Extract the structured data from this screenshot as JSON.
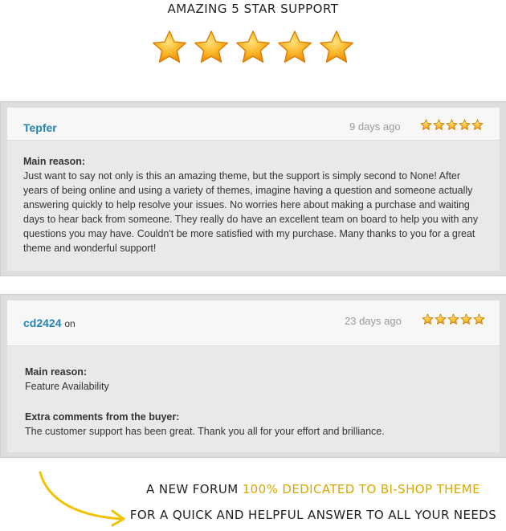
{
  "header": {
    "title": "AMAZING 5 STAR SUPPORT",
    "rating": 5
  },
  "reviews": [
    {
      "reviewer": "Tepfer",
      "reviewer_suffix": "",
      "time": "9 days ago",
      "rating": 5,
      "reason_label": "Main reason:",
      "body": "Just want to say not only is this an amazing theme, but the support is simply second to None! After years of being online and using a variety of themes, imagine having a question and someone actually answering quickly to help resolve your issues. No worries here about making a purchase and waiting days to hear back from someone. They really do have an excellent team on board to help you with any questions you may have. Couldn't be more satisfied with my purchase. Many thanks to you for a great theme and wonderful support!"
    },
    {
      "reviewer": "cd2424",
      "reviewer_suffix": "on",
      "time": "23 days ago",
      "rating": 5,
      "reason_label": "Main reason:",
      "reason_value": "Feature Availability",
      "comments_label": "Extra comments from the buyer:",
      "comments": "The customer support has been great. Thank you all for your effort and brilliance."
    }
  ],
  "footer": {
    "line1_pre": "A NEW FORUM",
    "line1_highlight": "100% DEDICATED TO BI-SHOP THEME",
    "line2": "FOR A QUICK AND HELPFUL ANSWER TO ALL YOUR NEEDS"
  },
  "colors": {
    "star": "#f7a31c",
    "link": "#2585b2",
    "highlight": "#d8a800",
    "arrow": "#f2c200"
  }
}
